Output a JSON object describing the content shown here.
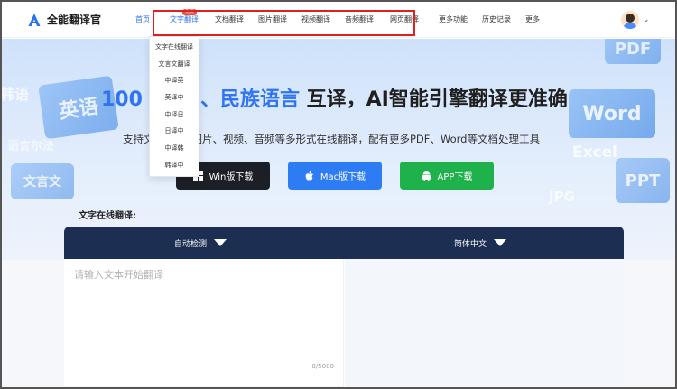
{
  "header": {
    "app_name": "全能翻译官",
    "nav": [
      {
        "label": "首页"
      },
      {
        "label": "文字翻译",
        "badge": "免费"
      },
      {
        "label": "文档翻译"
      },
      {
        "label": "图片翻译"
      },
      {
        "label": "视频翻译"
      },
      {
        "label": "音频翻译"
      },
      {
        "label": "网页翻译"
      },
      {
        "label": "更多功能"
      },
      {
        "label": "历史记录"
      },
      {
        "label": "更多"
      }
    ]
  },
  "dropdown": [
    "文字在线翻译",
    "文言文翻译",
    "中译英",
    "英译中",
    "中译日",
    "日译中",
    "中译韩",
    "韩译中"
  ],
  "hero": {
    "headline_start": "100",
    "headline_blue": "、民族语言",
    "headline_end": " 互译，AI智能引擎翻译更准确",
    "sub_a": "支持文",
    "sub_b": "图片、视频、音频等多形式在线翻译，配有更多PDF、Word等文档处理工具",
    "deco": {
      "english": "英语",
      "korean": "韩语",
      "classical": "文言文",
      "french": "语言尔法",
      "pdf": "PDF",
      "word": "Word",
      "excel": "Excel",
      "ppt": "PPT",
      "jpg": "JPG"
    }
  },
  "downloads": {
    "win": "Win版下载",
    "mac": "Mac版下载",
    "app": "APP下载"
  },
  "translator": {
    "section_title": "文字在线翻译:",
    "source_lang": "自动检测",
    "target_lang": "简体中文",
    "placeholder": "请输入文本开始翻译",
    "counter": "0/5000"
  },
  "colors": {
    "accent": "#2b6ff5",
    "panel_header": "#1c2f52",
    "mac_btn": "#2d7cf4",
    "app_btn": "#1fb14b",
    "win_btn": "#1c1f26",
    "highlight_box": "#e02020"
  }
}
